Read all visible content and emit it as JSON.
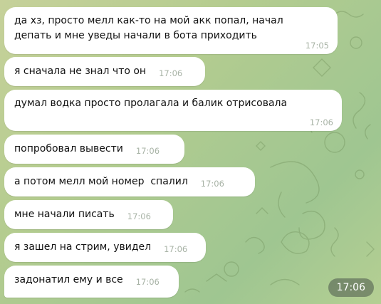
{
  "messages": [
    {
      "text": "да хз, просто мелл как-то на мой акк попал, начал\nдепать и мне уведы начали в бота приходить",
      "time": "17:05"
    },
    {
      "text": "я сначала не знал что он",
      "time": "17:06"
    },
    {
      "text": "думал водка просто пролагала и балик отрисовала",
      "time": "17:06"
    },
    {
      "text": "попробовал вывести",
      "time": "17:06"
    },
    {
      "text": "а потом мелл мой номер  спалил",
      "time": "17:06"
    },
    {
      "text": "мне начали писать",
      "time": "17:06"
    },
    {
      "text": "я зашел на стрим, увидел",
      "time": "17:06"
    },
    {
      "text": "задонатил ему и все",
      "time": "17:06"
    }
  ],
  "overlay_time": "17:06",
  "colors": {
    "bubble": "#ffffff",
    "time": "#a8b3a6",
    "background": "#b4cc8f"
  }
}
